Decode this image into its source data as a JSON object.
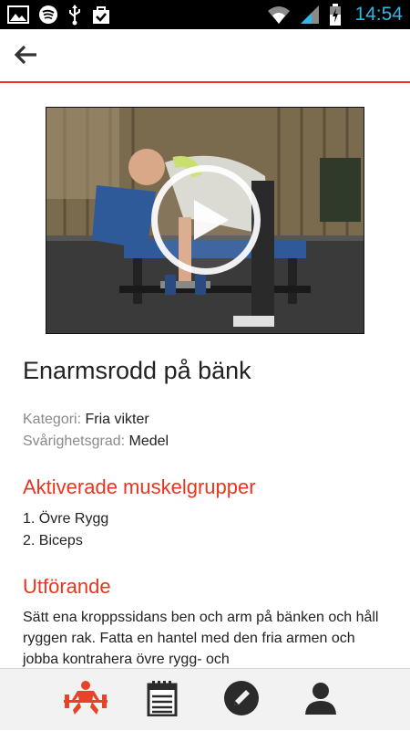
{
  "status_bar": {
    "time": "14:54",
    "left_icons": [
      "image-icon",
      "spotify-icon",
      "usb-icon",
      "shopping-bag-icon"
    ],
    "right_icons": [
      "wifi-icon",
      "signal-icon",
      "battery-icon"
    ]
  },
  "app_bar": {
    "back_icon": "arrow-left-icon",
    "accent_color": "#e8362a"
  },
  "exercise": {
    "title": "Enarmsrodd på bänk",
    "category_label": "Kategori:",
    "category_value": "Fria vikter",
    "difficulty_label": "Svårighetsgrad:",
    "difficulty_value": "Medel",
    "muscles_heading": "Aktiverade muskelgrupper",
    "muscles": [
      "1. Övre Rygg",
      "2. Biceps"
    ],
    "execution_heading": "Utförande",
    "execution_text": "Sätt ena kroppssidans ben och arm på bänken och håll ryggen rak. Fatta en hantel med den fria armen och jobba kontrahera övre rygg- och"
  },
  "video": {
    "play_icon": "play-icon"
  },
  "bottom_nav": {
    "items": [
      {
        "icon": "weightlifter-icon",
        "active": true,
        "color": "#e8432a"
      },
      {
        "icon": "notepad-icon",
        "active": false,
        "color": "#2b2b2b"
      },
      {
        "icon": "pencil-icon",
        "active": false,
        "color": "#2b2b2b"
      },
      {
        "icon": "person-icon",
        "active": false,
        "color": "#2b2b2b"
      }
    ]
  }
}
